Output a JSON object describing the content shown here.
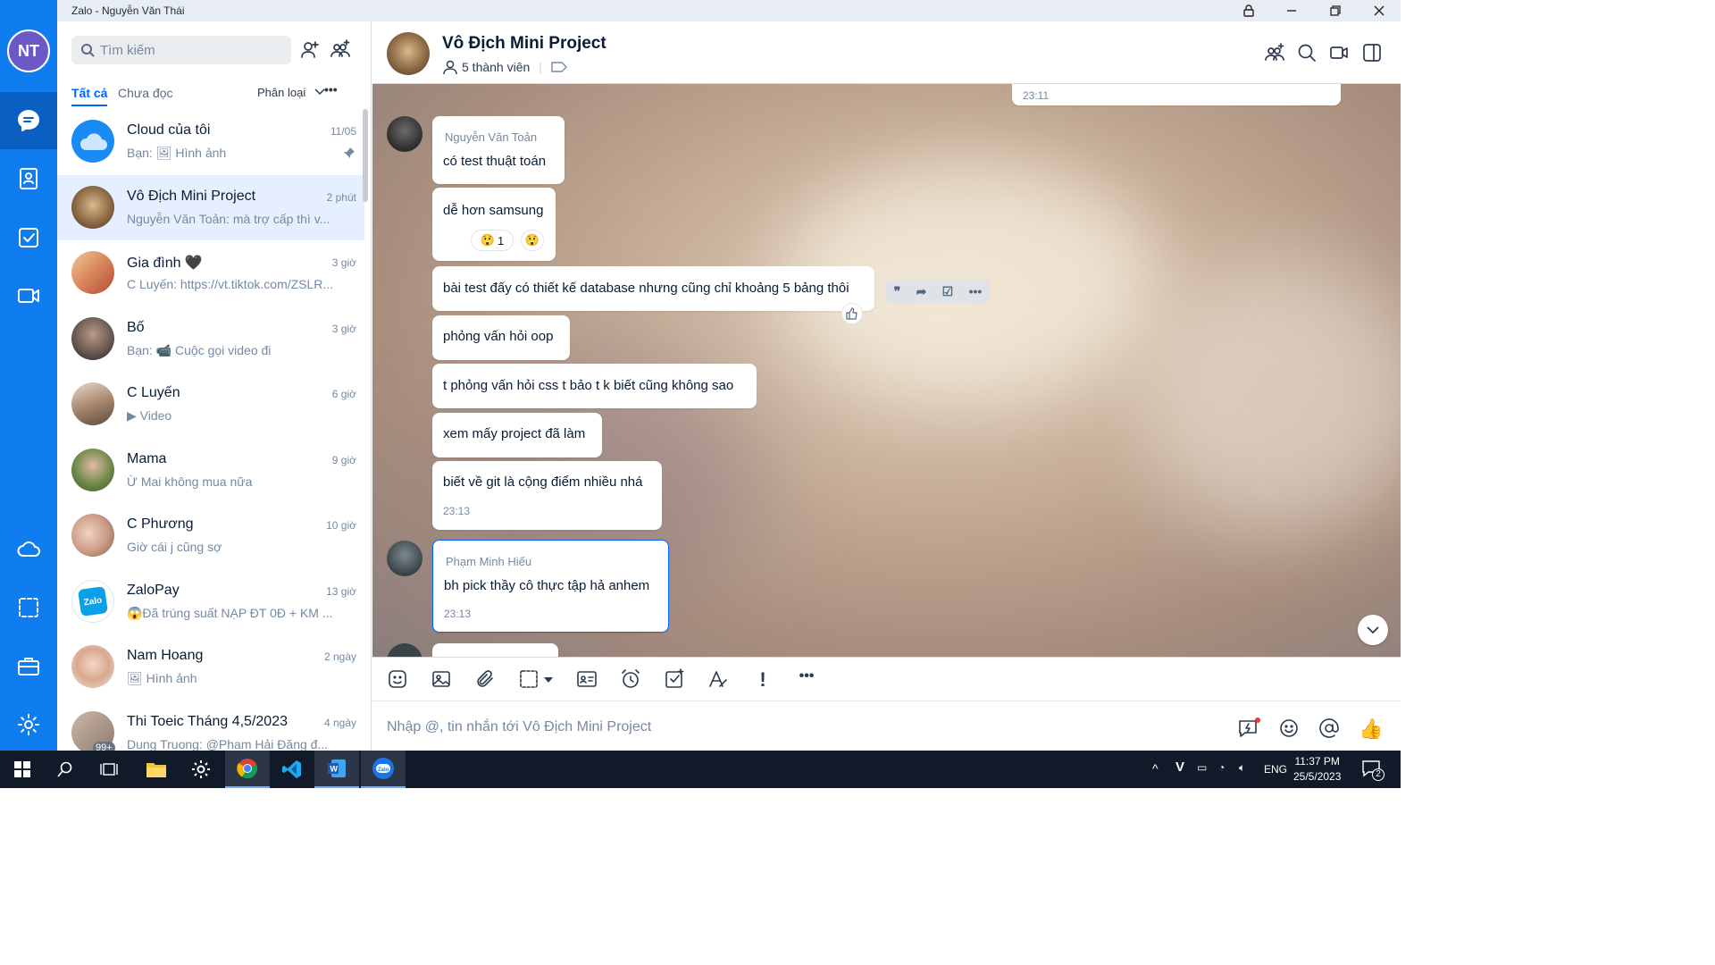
{
  "window": {
    "title": "Zalo - Nguyễn Văn Thái"
  },
  "rail": {
    "avatar_initials": "NT"
  },
  "sidebar": {
    "search_placeholder": "Tìm kiếm",
    "tabs": [
      "Tất cả",
      "Chưa đọc"
    ],
    "filter_label": "Phân loại",
    "conversations": [
      {
        "name": "Cloud của tôi",
        "time": "11/05",
        "preview": "Bạn: 🖼 Hình ảnh",
        "pinned": true
      },
      {
        "name": "Vô Địch Mini Project",
        "time": "2 phút",
        "preview": "Nguyễn Văn Toản: mà trợ cấp thì v..."
      },
      {
        "name": "Gia đình 🖤",
        "time": "3 giờ",
        "preview": "C Luyến: https://vt.tiktok.com/ZSLR..."
      },
      {
        "name": "Bố",
        "time": "3 giờ",
        "preview": "Bạn: 📹 Cuộc gọi video đi"
      },
      {
        "name": "C Luyến",
        "time": "6 giờ",
        "preview": "▶ Video"
      },
      {
        "name": "Mama",
        "time": "9 giờ",
        "preview": "Ừ Mai không mua nữa"
      },
      {
        "name": "C Phương",
        "time": "10 giờ",
        "preview": "Giờ cái j cũng sợ"
      },
      {
        "name": "ZaloPay",
        "time": "13 giờ",
        "preview": "😱Đã trúng suất NẠP ĐT 0Đ + KM ..."
      },
      {
        "name": "Nam Hoang",
        "time": "2 ngày",
        "preview": "🖼 Hình ảnh"
      },
      {
        "name": "Thi Toeic Tháng 4,5/2023",
        "time": "4 ngày",
        "preview": "Dung Truong: @Pham Hải Đăng đ...",
        "badge": "99+"
      }
    ]
  },
  "chat": {
    "group_name": "Vô Địch Mini Project",
    "members": "5 thành viên",
    "prev_time": "23:11",
    "messages": [
      {
        "sender": "Nguyễn Văn Toản",
        "text": "có test thuật toán"
      },
      {
        "text": "dễ hơn samsung",
        "reaction_count": "1"
      },
      {
        "text": "bài test đấy có thiết kế database nhưng cũng chỉ khoảng 5 bảng thôi"
      },
      {
        "text": "phỏng vấn hỏi oop"
      },
      {
        "text": "t phỏng vấn hỏi css t bảo t k biết cũng không sao"
      },
      {
        "text": "xem mấy project đã làm"
      },
      {
        "text": "biết về git là cộng điểm nhiều nhá",
        "time": "23:13"
      },
      {
        "sender": "Phạm Minh Hiếu",
        "text": "bh pick thầy cô thực tập hả anhem",
        "time": "23:13"
      }
    ],
    "composer_placeholder": "Nhập @, tin nhắn tới Vô Địch Mini Project"
  },
  "taskbar": {
    "lang": "ENG",
    "time": "11:37 PM",
    "date": "25/5/2023",
    "notif_count": "2"
  },
  "colors": {
    "accent": "#0068ff",
    "rail": "#0f7cf0",
    "selected": "#e5efff"
  }
}
